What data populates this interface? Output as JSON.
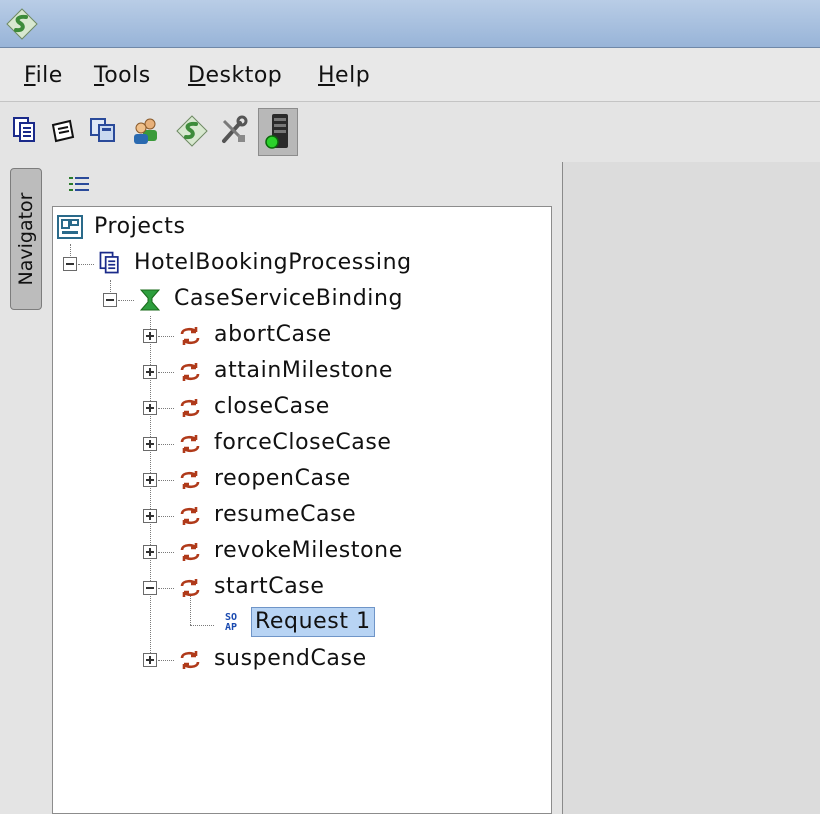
{
  "menu": {
    "file": {
      "mnemonic": "F",
      "rest": "ile"
    },
    "tools": {
      "mnemonic": "T",
      "rest": "ools"
    },
    "desktop": {
      "mnemonic": "D",
      "rest": "esktop"
    },
    "help": {
      "mnemonic": "H",
      "rest": "elp"
    }
  },
  "toolbar_icons": [
    "project-icon",
    "open-icon",
    "copy-icon",
    "users-icon",
    "app-logo-icon",
    "tools-icon",
    "server-monitor-icon"
  ],
  "navigator": {
    "tab_label": "Navigator"
  },
  "tree": {
    "root": "Projects",
    "project": "HotelBookingProcessing",
    "binding": "CaseServiceBinding",
    "operations": {
      "abortCase": "abortCase",
      "attainMilestone": "attainMilestone",
      "closeCase": "closeCase",
      "forceCloseCase": "forceCloseCase",
      "reopenCase": "reopenCase",
      "resumeCase": "resumeCase",
      "revokeMilestone": "revokeMilestone",
      "startCase": "startCase",
      "suspendCase": "suspendCase"
    },
    "request": "Request 1",
    "request_icon_text": "SO AP"
  },
  "colors": {
    "titlebar": "#a8c1e0",
    "selection": "#b8d4f4",
    "operation_icon": "#b03a1a",
    "binding_icon": "#2e9e3e"
  }
}
